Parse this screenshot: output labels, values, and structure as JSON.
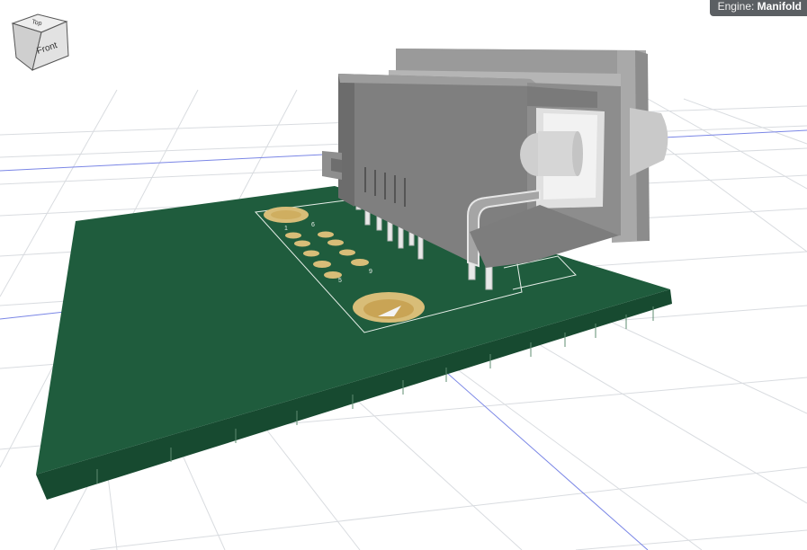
{
  "engine": {
    "label": "Engine:",
    "value": "Manifold"
  },
  "view_cube": {
    "top_label": "Top",
    "front_label": "Front"
  },
  "silkscreen": {
    "pin_1": "1",
    "pin_5": "5",
    "pin_6": "6",
    "pin_9": "9"
  },
  "colors": {
    "board": "#1e5a3c",
    "board_edge": "#174a30",
    "pad": "#d9bf7c",
    "connector_body": "#8a8a8a",
    "connector_shadow": "#6e6e6e",
    "grid_major": "#dadde0",
    "grid_axis": "#6a78e0",
    "badge": "#5b5f63"
  }
}
